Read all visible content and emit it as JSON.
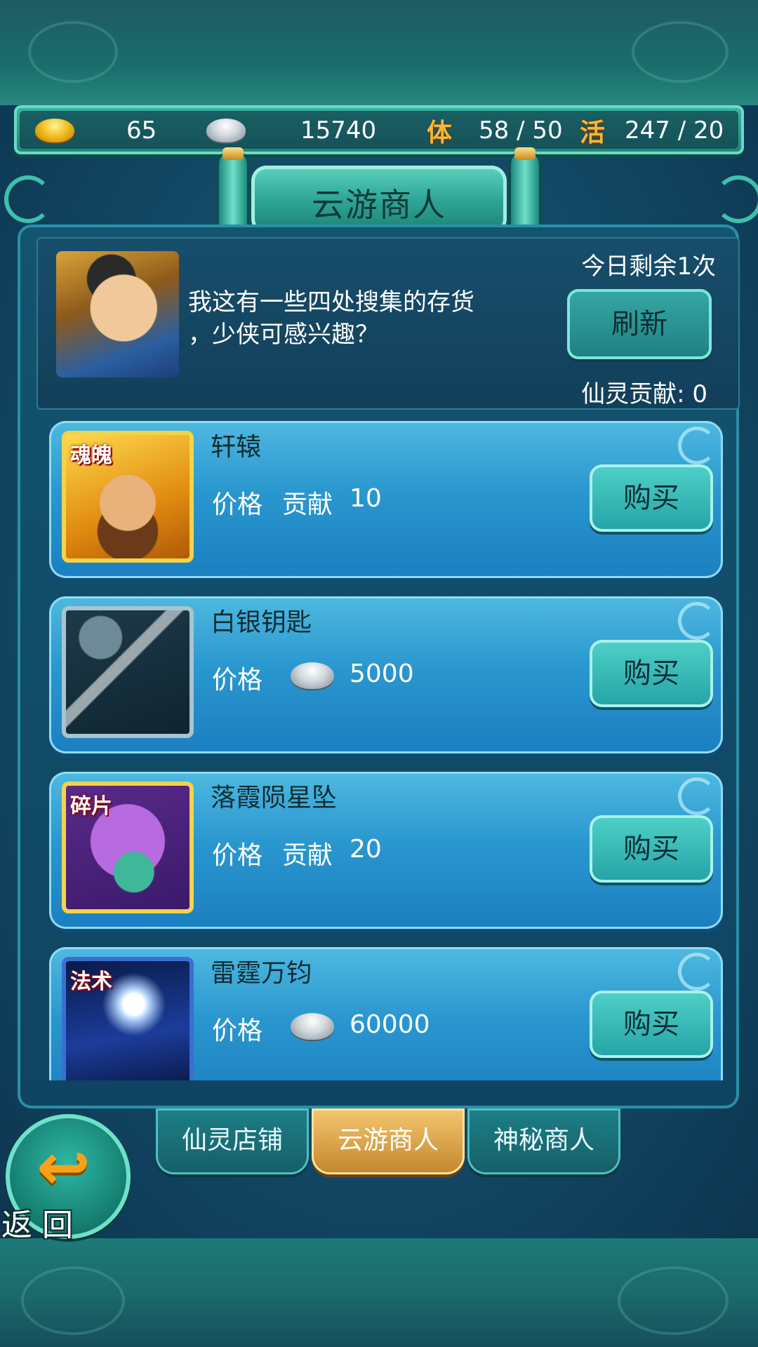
{
  "resources": {
    "gold": "65",
    "silver": "15740",
    "stamina_icon_char": "体",
    "stamina": "58 / 50",
    "vitality_icon_char": "活",
    "vitality": "247 / 20"
  },
  "title": "云游商人",
  "merchant": {
    "dialogue": "我这有一些四处搜集的存货\n，少侠可感兴趣？",
    "remaining": "今日剩余1次",
    "refresh_label": "刷新",
    "contribution": "仙灵贡献: 0"
  },
  "items": [
    {
      "tag": "魂魄",
      "name": "轩辕",
      "price_label": "价格",
      "currency": "贡献",
      "price": "10",
      "buy_label": "购买"
    },
    {
      "tag": "",
      "name": "白银钥匙",
      "price_label": "价格",
      "currency": "silver-ingot-icon",
      "price": "5000",
      "buy_label": "购买"
    },
    {
      "tag": "碎片",
      "name": "落霞陨星坠",
      "price_label": "价格",
      "currency": "贡献",
      "price": "20",
      "buy_label": "购买"
    },
    {
      "tag": "法术",
      "name": "雷霆万钧",
      "price_label": "价格",
      "currency": "silver-ingot-icon",
      "price": "60000",
      "buy_label": "购买"
    }
  ],
  "tabs": [
    {
      "label": "仙灵店铺",
      "active": false
    },
    {
      "label": "云游商人",
      "active": true
    },
    {
      "label": "神秘商人",
      "active": false
    }
  ],
  "back": {
    "label": "返回"
  },
  "colors": {
    "panel": "#13546f",
    "card": "#2a97cf",
    "tab_active": "#f4c770",
    "tab_inactive": "#1e7f86",
    "accent_gold": "#f9b53a"
  }
}
